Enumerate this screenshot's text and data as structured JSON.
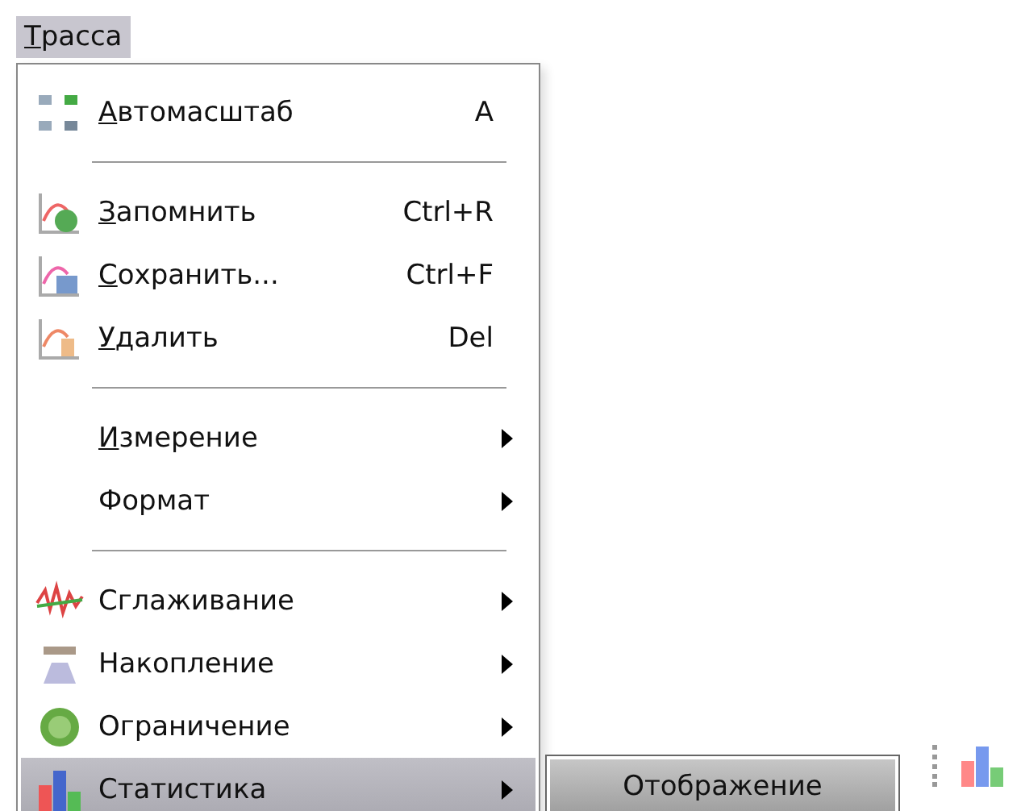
{
  "menubar": {
    "title": "Трасса",
    "mnemonic": true,
    "selected": true
  },
  "menu": {
    "items": [
      {
        "kind": "command",
        "label": "Автомасштаб",
        "mnemonic": true,
        "shortcut": "A",
        "selected": false
      },
      {
        "kind": "separator"
      },
      {
        "kind": "command",
        "label": "Запомнить",
        "mnemonic": true,
        "shortcut": "Ctrl+R",
        "selected": false
      },
      {
        "kind": "command",
        "label": "Сохранить...",
        "mnemonic": true,
        "shortcut": "Ctrl+F",
        "selected": false
      },
      {
        "kind": "command",
        "label": "Удалить",
        "mnemonic": true,
        "shortcut": "Del",
        "selected": false
      },
      {
        "kind": "separator"
      },
      {
        "kind": "submenu",
        "label": "Измерение",
        "mnemonic": true,
        "selected": false
      },
      {
        "kind": "submenu",
        "label": "Формат",
        "mnemonic": false,
        "selected": false
      },
      {
        "kind": "separator"
      },
      {
        "kind": "submenu",
        "label": "Сглаживание",
        "mnemonic": false,
        "selected": false
      },
      {
        "kind": "submenu",
        "label": "Накопление",
        "mnemonic": false,
        "selected": false
      },
      {
        "kind": "submenu",
        "label": "Ограничение",
        "mnemonic": false,
        "selected": false
      },
      {
        "kind": "submenu",
        "label": "Статистика",
        "mnemonic": false,
        "selected": true,
        "children": [
          {
            "label": "Отображение",
            "selected": true
          }
        ]
      }
    ]
  }
}
